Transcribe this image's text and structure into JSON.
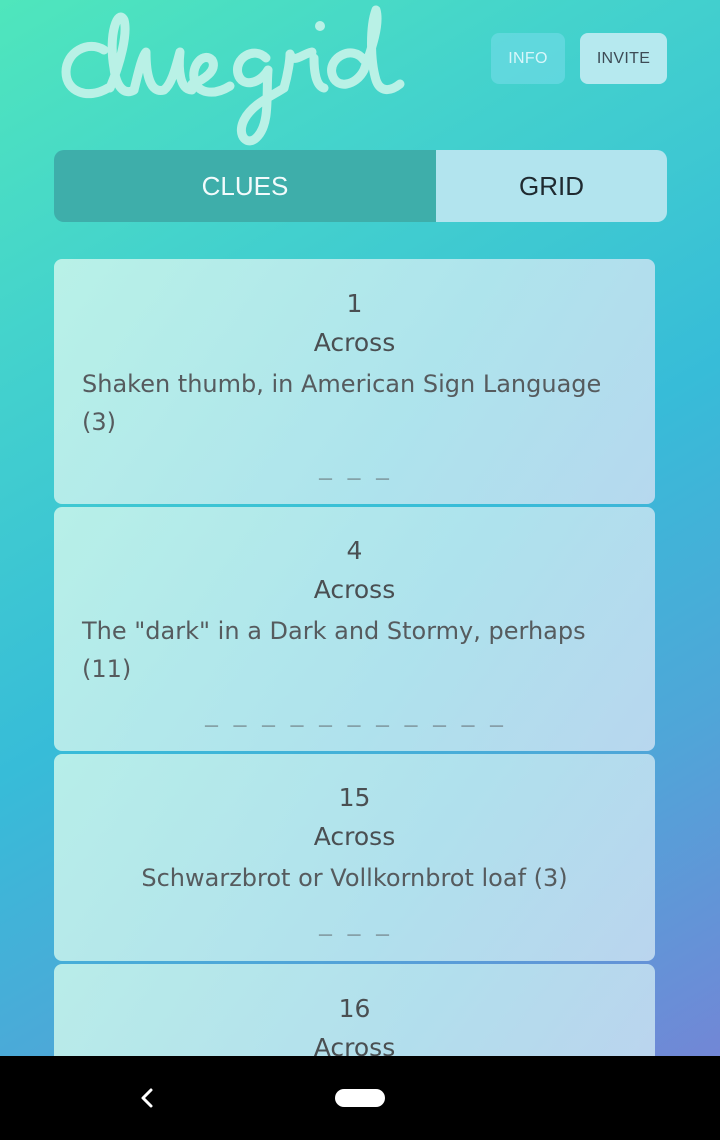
{
  "app": {
    "logo_text": "cluegrid"
  },
  "header": {
    "info_label": "INFO",
    "invite_label": "INVITE"
  },
  "tabs": {
    "clues_label": "CLUES",
    "grid_label": "GRID",
    "active": "clues"
  },
  "clues": [
    {
      "number": "1",
      "direction": "Across",
      "text": "Shaken thumb, in American Sign Language (3)",
      "blanks": "_ _ _"
    },
    {
      "number": "4",
      "direction": "Across",
      "text": "The \"dark\" in a Dark and Stormy, perhaps (11)",
      "blanks": "_ _ _ _ _ _ _ _ _ _ _"
    },
    {
      "number": "15",
      "direction": "Across",
      "text": "Schwarzbrot or Vollkornbrot loaf (3)",
      "blanks": "_ _ _"
    },
    {
      "number": "16",
      "direction": "Across",
      "text": "",
      "blanks": ""
    }
  ],
  "colors": {
    "tab_active": "#3eaeaa",
    "tab_inactive": "#b2e4ee",
    "logo": "#b9f1e6",
    "navbar": "#000000"
  },
  "icons": {
    "back": "chevron-left-icon",
    "home": "home-pill-icon"
  }
}
